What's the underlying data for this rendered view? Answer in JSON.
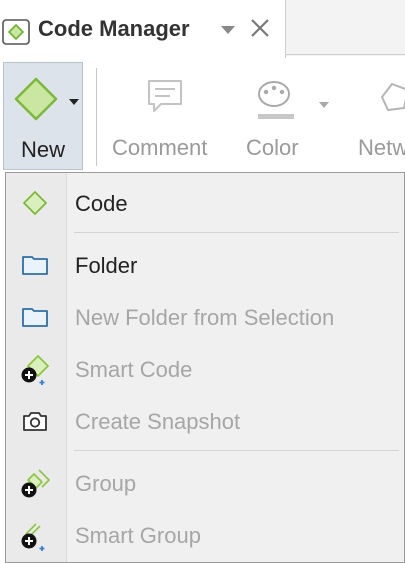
{
  "tab": {
    "title": "Code Manager",
    "icon": "code-diamond-icon",
    "dropdown_icon": "chevron-down-icon",
    "close_icon": "close-icon"
  },
  "ribbon": {
    "new_label": "New",
    "comment_label": "Comment",
    "color_label": "Color",
    "network_label": "Netw"
  },
  "menu": {
    "items": [
      {
        "label": "Code",
        "icon": "code-diamond-icon",
        "enabled": true
      },
      {
        "label": "Folder",
        "icon": "folder-icon",
        "enabled": true
      },
      {
        "label": "New Folder from Selection",
        "icon": "folder-icon",
        "enabled": false
      },
      {
        "label": "Smart Code",
        "icon": "smart-code-icon",
        "enabled": false
      },
      {
        "label": "Create Snapshot",
        "icon": "camera-icon",
        "enabled": false
      },
      {
        "label": "Group",
        "icon": "group-add-icon",
        "enabled": false
      },
      {
        "label": "Smart Group",
        "icon": "smart-group-icon",
        "enabled": false
      }
    ]
  },
  "colors": {
    "accent_green": "#8cc63f",
    "folder_blue": "#2e6ea6",
    "selected_button_bg": "#dde3ea",
    "disabled_text": "#a6a6a6"
  }
}
